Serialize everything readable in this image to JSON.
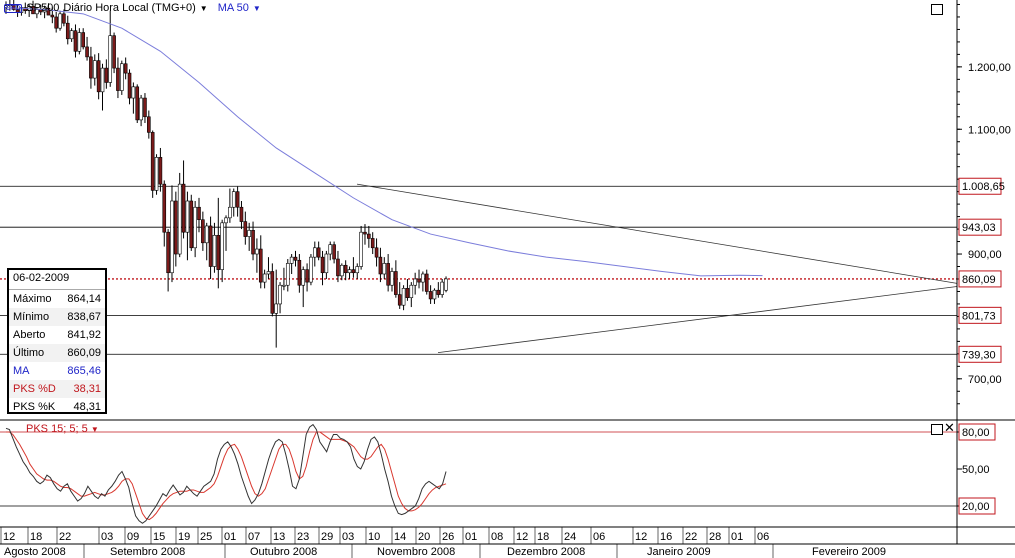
{
  "header": {
    "cfd_badge": "CFD",
    "symbol": "SP500",
    "period": "Diário Hora Local (TMG+0)",
    "ma_label": "MA 50",
    "dropdown_glyph": "▼"
  },
  "indicator": {
    "title": "PKS 15; 5; 5",
    "levels": [
      "80,00",
      "50,00",
      "20,00"
    ]
  },
  "info_panel": {
    "date": "06-02-2009",
    "rows": [
      {
        "label": "Máximo",
        "value": "864,14"
      },
      {
        "label": "Mínimo",
        "value": "838,67"
      },
      {
        "label": "Aberto",
        "value": "841,92"
      },
      {
        "label": "Último",
        "value": "860,09"
      },
      {
        "label": "MA",
        "value": "865,46"
      },
      {
        "label": "PKS %D",
        "value": "38,31"
      },
      {
        "label": "PKS %K",
        "value": "48,31"
      }
    ]
  },
  "colors": {
    "up_candle": "#ffffff",
    "down_candle": "#7a1a1a",
    "ma_line": "#7b7ddb",
    "current_price": "#c0161c",
    "pks_d": "#d9382f",
    "pks_k": "#333333",
    "label_box_border": "#c0161c"
  },
  "chart_data": {
    "type": "candlestick",
    "title": "SP500 Diário Hora Local (TMG+0)",
    "price_axis": {
      "range": [
        650,
        1320
      ],
      "ticks": [
        "1.200,00",
        "1.100,00",
        "900,00",
        "700,00"
      ],
      "tick_values": [
        1200,
        1100,
        900,
        700
      ]
    },
    "horizontal_levels": [
      {
        "value": 1008.65,
        "label": "1.008,65"
      },
      {
        "value": 943.03,
        "label": "943,03"
      },
      {
        "value": 801.73,
        "label": "801,73"
      },
      {
        "value": 739.3,
        "label": "739,30"
      }
    ],
    "current_price": {
      "value": 860.09,
      "label": "860,09"
    },
    "trendlines": [
      {
        "from": [
          "2008-10-31",
          1012
        ],
        "to": [
          "2009-03-03",
          853
        ]
      },
      {
        "from": [
          "2008-11-20",
          742
        ],
        "to": [
          "2009-03-03",
          848
        ]
      }
    ],
    "x_day_labels": [
      "12",
      "18",
      "22",
      "03",
      "09",
      "15",
      "19",
      "25",
      "01",
      "07",
      "13",
      "23",
      "29",
      "03",
      "10",
      "14",
      "20",
      "26",
      "01",
      "08",
      "12",
      "18",
      "24",
      "06",
      "12",
      "16",
      "22",
      "28",
      "01",
      "06"
    ],
    "x_month_labels": [
      "Agosto 2008",
      "Setembro 2008",
      "Outubro 2008",
      "Novembro 2008",
      "Dezembro 2008",
      "Janeiro 2009",
      "Fevereiro 2009"
    ],
    "candles_ohlc": [
      [
        1295,
        1305,
        1285,
        1298
      ],
      [
        1298,
        1312,
        1290,
        1300
      ],
      [
        1300,
        1308,
        1290,
        1292
      ],
      [
        1292,
        1300,
        1280,
        1287
      ],
      [
        1287,
        1298,
        1282,
        1295
      ],
      [
        1295,
        1303,
        1285,
        1290
      ],
      [
        1290,
        1300,
        1280,
        1297
      ],
      [
        1297,
        1306,
        1288,
        1285
      ],
      [
        1285,
        1296,
        1278,
        1292
      ],
      [
        1292,
        1300,
        1283,
        1288
      ],
      [
        1288,
        1298,
        1278,
        1294
      ],
      [
        1294,
        1302,
        1285,
        1283
      ],
      [
        1283,
        1295,
        1270,
        1280
      ],
      [
        1280,
        1288,
        1255,
        1262
      ],
      [
        1262,
        1290,
        1258,
        1285
      ],
      [
        1285,
        1292,
        1265,
        1270
      ],
      [
        1270,
        1282,
        1236,
        1245
      ],
      [
        1245,
        1262,
        1240,
        1258
      ],
      [
        1258,
        1268,
        1215,
        1225
      ],
      [
        1225,
        1262,
        1220,
        1255
      ],
      [
        1255,
        1262,
        1228,
        1232
      ],
      [
        1232,
        1248,
        1210,
        1216
      ],
      [
        1216,
        1232,
        1165,
        1182
      ],
      [
        1182,
        1220,
        1170,
        1210
      ],
      [
        1210,
        1222,
        1148,
        1160
      ],
      [
        1160,
        1205,
        1130,
        1198
      ],
      [
        1198,
        1212,
        1165,
        1175
      ],
      [
        1175,
        1290,
        1168,
        1250
      ],
      [
        1250,
        1255,
        1190,
        1198
      ],
      [
        1198,
        1215,
        1150,
        1162
      ],
      [
        1162,
        1210,
        1155,
        1205
      ],
      [
        1205,
        1215,
        1180,
        1190
      ],
      [
        1190,
        1196,
        1140,
        1150
      ],
      [
        1150,
        1175,
        1125,
        1168
      ],
      [
        1168,
        1172,
        1110,
        1115
      ],
      [
        1115,
        1155,
        1105,
        1150
      ],
      [
        1150,
        1158,
        1110,
        1120
      ],
      [
        1120,
        1130,
        1085,
        1095
      ],
      [
        1095,
        1098,
        990,
        1002
      ],
      [
        1002,
        1060,
        995,
        1055
      ],
      [
        1055,
        1070,
        1000,
        1012
      ],
      [
        1012,
        1018,
        912,
        935
      ],
      [
        935,
        940,
        840,
        870
      ],
      [
        870,
        1010,
        855,
        985
      ],
      [
        985,
        1000,
        880,
        900
      ],
      [
        900,
        1030,
        895,
        1012
      ],
      [
        1012,
        1050,
        925,
        935
      ],
      [
        935,
        1000,
        890,
        985
      ],
      [
        985,
        995,
        905,
        910
      ],
      [
        910,
        985,
        895,
        975
      ],
      [
        975,
        990,
        935,
        955
      ],
      [
        955,
        968,
        905,
        918
      ],
      [
        918,
        950,
        890,
        945
      ],
      [
        945,
        960,
        860,
        880
      ],
      [
        880,
        950,
        870,
        930
      ],
      [
        930,
        990,
        845,
        875
      ],
      [
        875,
        955,
        855,
        950
      ],
      [
        950,
        962,
        905,
        958
      ],
      [
        958,
        1005,
        950,
        975
      ],
      [
        975,
        1005,
        960,
        1000
      ],
      [
        1000,
        1008,
        960,
        975
      ],
      [
        975,
        985,
        940,
        952
      ],
      [
        952,
        968,
        915,
        928
      ],
      [
        928,
        950,
        905,
        938
      ],
      [
        938,
        952,
        890,
        900
      ],
      [
        900,
        925,
        870,
        908
      ],
      [
        908,
        930,
        845,
        855
      ],
      [
        855,
        875,
        845,
        868
      ],
      [
        868,
        895,
        860,
        872
      ],
      [
        872,
        885,
        800,
        805
      ],
      [
        805,
        875,
        750,
        820
      ],
      [
        820,
        855,
        805,
        850
      ],
      [
        850,
        878,
        842,
        850
      ],
      [
        850,
        892,
        840,
        885
      ],
      [
        885,
        900,
        868,
        895
      ],
      [
        895,
        905,
        880,
        890
      ],
      [
        890,
        900,
        838,
        850
      ],
      [
        850,
        880,
        815,
        875
      ],
      [
        875,
        885,
        840,
        855
      ],
      [
        855,
        900,
        850,
        895
      ],
      [
        895,
        920,
        880,
        910
      ],
      [
        910,
        920,
        890,
        895
      ],
      [
        895,
        905,
        850,
        870
      ],
      [
        870,
        905,
        860,
        900
      ],
      [
        900,
        920,
        890,
        915
      ],
      [
        915,
        920,
        885,
        892
      ],
      [
        892,
        905,
        855,
        865
      ],
      [
        865,
        885,
        858,
        882
      ],
      [
        882,
        890,
        858,
        870
      ],
      [
        870,
        880,
        860,
        875
      ],
      [
        875,
        895,
        862,
        870
      ],
      [
        870,
        885,
        860,
        880
      ],
      [
        880,
        945,
        875,
        935
      ],
      [
        935,
        948,
        915,
        932
      ],
      [
        932,
        945,
        910,
        925
      ],
      [
        925,
        935,
        900,
        910
      ],
      [
        910,
        925,
        880,
        895
      ],
      [
        895,
        910,
        855,
        868
      ],
      [
        868,
        895,
        860,
        885
      ],
      [
        885,
        900,
        840,
        850
      ],
      [
        850,
        878,
        840,
        872
      ],
      [
        872,
        890,
        830,
        835
      ],
      [
        835,
        855,
        812,
        818
      ],
      [
        818,
        850,
        810,
        845
      ],
      [
        845,
        860,
        825,
        830
      ],
      [
        830,
        855,
        815,
        850
      ],
      [
        850,
        870,
        835,
        860
      ],
      [
        860,
        875,
        845,
        855
      ],
      [
        855,
        872,
        840,
        868
      ],
      [
        868,
        875,
        835,
        840
      ],
      [
        840,
        850,
        820,
        828
      ],
      [
        828,
        845,
        820,
        842
      ],
      [
        842,
        855,
        830,
        835
      ],
      [
        835,
        860,
        830,
        855
      ],
      [
        841.92,
        864.14,
        838.67,
        860.09
      ]
    ],
    "ma50_approx": [
      [
        0,
        1295
      ],
      [
        10,
        1292
      ],
      [
        20,
        1285
      ],
      [
        30,
        1262
      ],
      [
        40,
        1225
      ],
      [
        50,
        1175
      ],
      [
        60,
        1120
      ],
      [
        70,
        1070
      ],
      [
        80,
        1030
      ],
      [
        90,
        990
      ],
      [
        100,
        955
      ],
      [
        110,
        932
      ],
      [
        120,
        918
      ],
      [
        130,
        905
      ],
      [
        140,
        895
      ],
      [
        150,
        888
      ],
      [
        160,
        880
      ],
      [
        170,
        872
      ],
      [
        180,
        865
      ],
      [
        190,
        866
      ],
      [
        196,
        865.46
      ]
    ],
    "pks_axis": {
      "range": [
        0,
        100
      ],
      "levels": [
        80,
        50,
        20
      ]
    },
    "pks_k_values": [
      83,
      82,
      75,
      68,
      62,
      56,
      52,
      47,
      44,
      40,
      38,
      40,
      45,
      43,
      38,
      34,
      32,
      36,
      38,
      32,
      28,
      24,
      26,
      30,
      36,
      32,
      28,
      26,
      30,
      28,
      33,
      36,
      40,
      45,
      48,
      42,
      35,
      22,
      12,
      8,
      6,
      8,
      12,
      16,
      20,
      25,
      30,
      28,
      33,
      37,
      33,
      29,
      31,
      36,
      33,
      30,
      28,
      32,
      36,
      38,
      40,
      46,
      58,
      66,
      70,
      72,
      68,
      62,
      54,
      44,
      36,
      28,
      22,
      25,
      30,
      38,
      48,
      58,
      66,
      72,
      74,
      72,
      62,
      50,
      36,
      34,
      42,
      60,
      78,
      84,
      86,
      82,
      72,
      68,
      64,
      72,
      78,
      78,
      75,
      74,
      72,
      68,
      58,
      52,
      50,
      56,
      66,
      74,
      76,
      72,
      62,
      50,
      40,
      28,
      20,
      14,
      13,
      14,
      16,
      18,
      20,
      26,
      34,
      38,
      40,
      38,
      36,
      34,
      38,
      48
    ],
    "pks_d_values": [
      80,
      80,
      78,
      74,
      70,
      65,
      60,
      54,
      50,
      46,
      44,
      42,
      41,
      41,
      40,
      38,
      36,
      35,
      35,
      34,
      32,
      30,
      28,
      28,
      29,
      30,
      31,
      30,
      29,
      29,
      30,
      31,
      33,
      36,
      40,
      42,
      42,
      38,
      30,
      22,
      14,
      10,
      9,
      11,
      14,
      18,
      22,
      25,
      28,
      30,
      31,
      32,
      32,
      32,
      33,
      33,
      32,
      31,
      31,
      33,
      35,
      38,
      44,
      52,
      60,
      66,
      69,
      70,
      66,
      60,
      52,
      44,
      36,
      30,
      28,
      30,
      34,
      42,
      50,
      58,
      66,
      70,
      70,
      66,
      58,
      48,
      42,
      44,
      52,
      64,
      74,
      80,
      80,
      78,
      76,
      74,
      74,
      74,
      74,
      73,
      72,
      70,
      68,
      64,
      60,
      58,
      58,
      60,
      64,
      68,
      70,
      66,
      58,
      48,
      38,
      28,
      22,
      18,
      16,
      16,
      17,
      19,
      22,
      26,
      30,
      33,
      35,
      36,
      37,
      38
    ],
    "pks_current": {
      "d": 38.31,
      "k": 48.31
    }
  }
}
